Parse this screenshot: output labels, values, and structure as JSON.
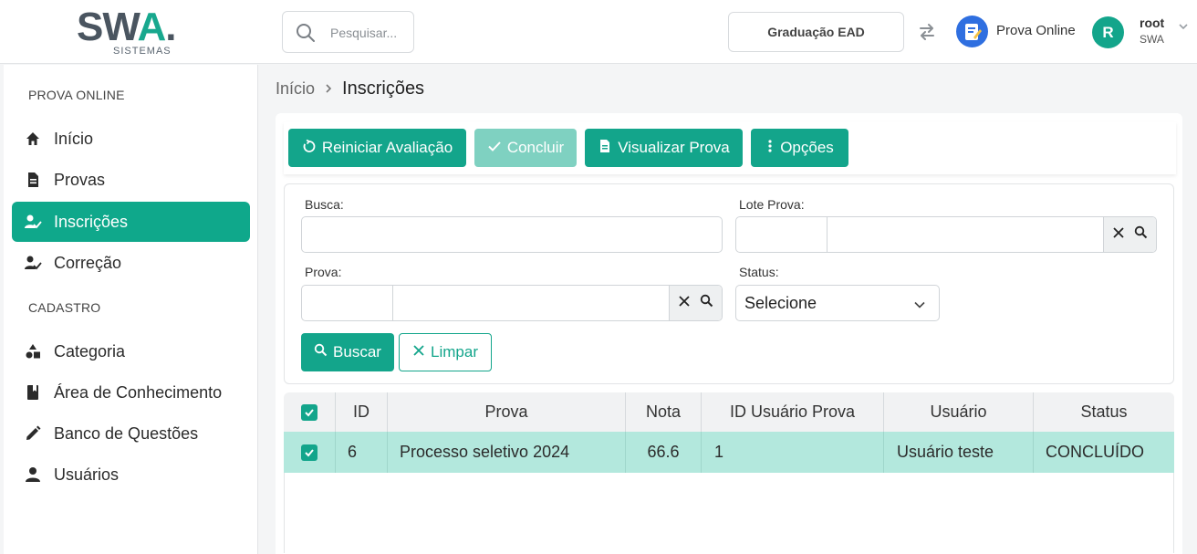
{
  "header": {
    "logo_text_start": "SW",
    "logo_text_accent": "A",
    "logo_text_end": ".",
    "logo_sub": "SISTEMAS",
    "search_placeholder": "Pesquisar...",
    "course_label": "Graduação EAD",
    "app_label": "Prova Online",
    "avatar_initial": "R",
    "user_name": "root",
    "user_org": "SWA"
  },
  "sidebar": {
    "section1": "PROVA ONLINE",
    "section2": "CADASTRO",
    "items": [
      {
        "label": "Início"
      },
      {
        "label": "Provas"
      },
      {
        "label": "Inscrições"
      },
      {
        "label": "Correção"
      },
      {
        "label": "Categoria"
      },
      {
        "label": "Área de Conhecimento"
      },
      {
        "label": "Banco de Questões"
      },
      {
        "label": "Usuários"
      }
    ]
  },
  "breadcrumb": {
    "home": "Início",
    "current": "Inscrições"
  },
  "toolbar": {
    "restart": "Reiniciar Avaliação",
    "conclude": "Concluir",
    "view": "Visualizar Prova",
    "options": "Opções"
  },
  "filter": {
    "busca_label": "Busca:",
    "lote_label": "Lote Prova:",
    "prova_label": "Prova:",
    "status_label": "Status:",
    "status_value": "Selecione",
    "search_btn": "Buscar",
    "clear_btn": "Limpar"
  },
  "table": {
    "headers": [
      "ID",
      "Prova",
      "Nota",
      "ID Usuário Prova",
      "Usuário",
      "Status"
    ],
    "rows": [
      {
        "id": "6",
        "prova": "Processo seletivo 2024",
        "nota": "66.6",
        "id_usuario_prova": "1",
        "usuario": "Usuário teste",
        "status": "CONCLUÍDO"
      }
    ]
  },
  "colors": {
    "accent": "#13a58b",
    "accent_light": "#b3e8dd",
    "app_icon": "#2f6fe0"
  }
}
